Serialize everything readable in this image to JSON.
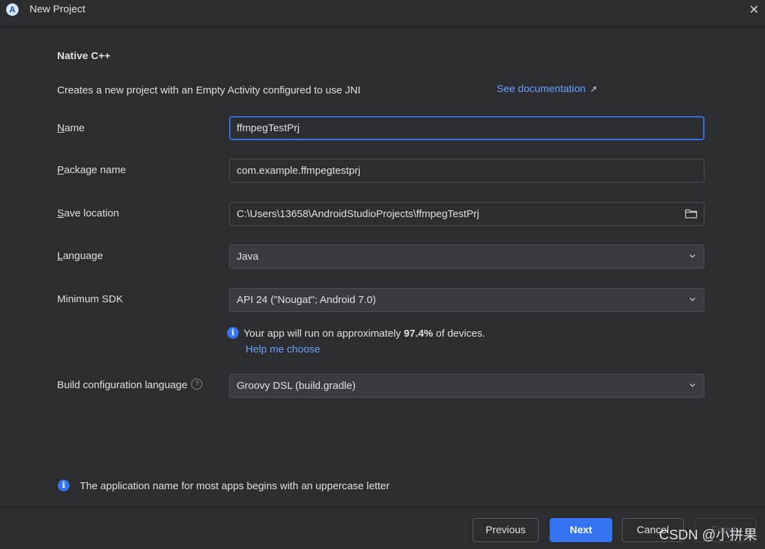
{
  "window": {
    "title": "New Project",
    "close_glyph": "✕"
  },
  "section": {
    "title": "Native C++",
    "description": "Creates a new project with an Empty Activity configured to use JNI",
    "doc_link": "See documentation",
    "doc_link_arrow": "↗"
  },
  "fields": {
    "name": {
      "label_mnemonic": "N",
      "label_rest": "ame",
      "value": "ffmpegTestPrj"
    },
    "package": {
      "label_mnemonic": "P",
      "label_rest": "ackage name",
      "value": "com.example.ffmpegtestprj"
    },
    "save_location": {
      "label_mnemonic": "S",
      "label_rest": "ave location",
      "value": "C:\\Users\\13658\\AndroidStudioProjects\\ffmpegTestPrj",
      "icon": "folder-icon"
    },
    "language": {
      "label_mnemonic": "L",
      "label_rest": "anguage",
      "value": "Java"
    },
    "min_sdk": {
      "label": "Minimum SDK",
      "value": "API 24 (\"Nougat\"; Android 7.0)"
    },
    "build_config": {
      "label": "Build configuration language",
      "value": "Groovy DSL (build.gradle)",
      "help_glyph": "?"
    }
  },
  "sdk_info": {
    "prefix": "Your app will run on approximately ",
    "percent": "97.4%",
    "suffix": " of devices.",
    "help_link": "Help me choose"
  },
  "bottom_info": {
    "text": "The application name for most apps begins with an uppercase letter"
  },
  "buttons": {
    "previous": "Previous",
    "next": "Next",
    "cancel": "Cancel",
    "finish": "Finish"
  },
  "watermark": "CSDN @小拼果",
  "colors": {
    "accent": "#3574f0",
    "link": "#6aa3ff",
    "background": "#2b2d30"
  }
}
